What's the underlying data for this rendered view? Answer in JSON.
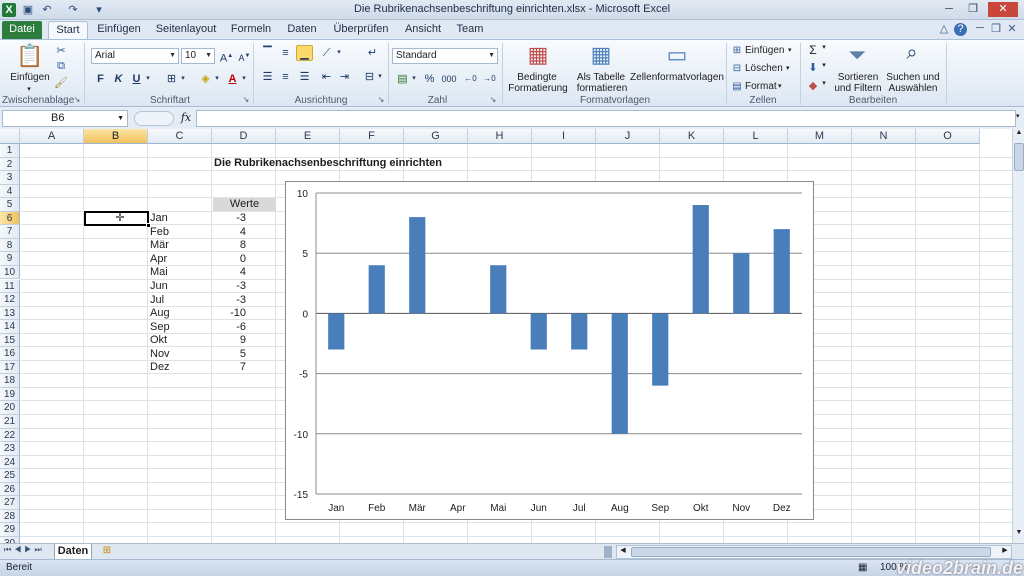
{
  "window": {
    "title": "Die Rubrikenachsenbeschriftung einrichten.xlsx - Microsoft Excel"
  },
  "tabs": [
    "Datei",
    "Start",
    "Einfügen",
    "Seitenlayout",
    "Formeln",
    "Daten",
    "Überprüfen",
    "Ansicht",
    "Team"
  ],
  "ribbon": {
    "clipboard": {
      "paste": "Einfügen",
      "group": "Zwischenablage"
    },
    "font": {
      "name": "Arial",
      "size": "10",
      "bold": "F",
      "italic": "K",
      "underline": "U",
      "group": "Schriftart"
    },
    "alignment": {
      "group": "Ausrichtung"
    },
    "number": {
      "format": "Standard",
      "percent": "%",
      "thousands": "000",
      "group": "Zahl"
    },
    "styles": {
      "conditional": "Bedingte",
      "conditional2": "Formatierung",
      "table": "Als Tabelle",
      "table2": "formatieren",
      "cellstyles": "Zellenformatvorlagen",
      "group": "Formatvorlagen"
    },
    "cells": {
      "insert": "Einfügen",
      "delete": "Löschen",
      "format": "Format",
      "group": "Zellen"
    },
    "editing": {
      "sort": "Sortieren",
      "sort2": "und Filtern",
      "find": "Suchen und",
      "find2": "Auswählen",
      "group": "Bearbeiten"
    }
  },
  "formula_bar": {
    "name_box": "B6",
    "fx": "fx",
    "value": ""
  },
  "columns": [
    "A",
    "B",
    "C",
    "D",
    "E",
    "F",
    "G",
    "H",
    "I",
    "J",
    "K",
    "L",
    "M",
    "N",
    "O"
  ],
  "rows": [
    "1",
    "2",
    "3",
    "4",
    "5",
    "6",
    "7",
    "8",
    "9",
    "10",
    "11",
    "12",
    "13",
    "14",
    "15",
    "16",
    "17",
    "18",
    "19",
    "20",
    "21",
    "22",
    "23",
    "24",
    "25",
    "26",
    "27",
    "28",
    "29",
    "30"
  ],
  "sheet": {
    "title": "Die Rubrikenachsenbeschriftung einrichten",
    "value_header": "Werte",
    "data": [
      {
        "month": "Jan",
        "value": "-3"
      },
      {
        "month": "Feb",
        "value": "4"
      },
      {
        "month": "Mär",
        "value": "8"
      },
      {
        "month": "Apr",
        "value": "0"
      },
      {
        "month": "Mai",
        "value": "4"
      },
      {
        "month": "Jun",
        "value": "-3"
      },
      {
        "month": "Jul",
        "value": "-3"
      },
      {
        "month": "Aug",
        "value": "-10"
      },
      {
        "month": "Sep",
        "value": "-6"
      },
      {
        "month": "Okt",
        "value": "9"
      },
      {
        "month": "Nov",
        "value": "5"
      },
      {
        "month": "Dez",
        "value": "7"
      }
    ]
  },
  "chart_data": {
    "type": "bar",
    "categories": [
      "Jan",
      "Feb",
      "Mär",
      "Apr",
      "Mai",
      "Jun",
      "Jul",
      "Aug",
      "Sep",
      "Okt",
      "Nov",
      "Dez"
    ],
    "values": [
      -3,
      4,
      8,
      0,
      4,
      -3,
      -3,
      -10,
      -6,
      9,
      5,
      7
    ],
    "ylim": [
      -15,
      10
    ],
    "yticks": [
      10,
      5,
      0,
      -5,
      -10,
      -15
    ],
    "grid": true,
    "bar_color": "#4a7ebb"
  },
  "sheet_tabs": [
    "Daten"
  ],
  "status": {
    "left": "Bereit",
    "zoom": "100 %"
  },
  "watermark": "video2brain.de",
  "colors": {
    "file_tab": "#2d7e3e",
    "selection": "#f1c15f"
  }
}
